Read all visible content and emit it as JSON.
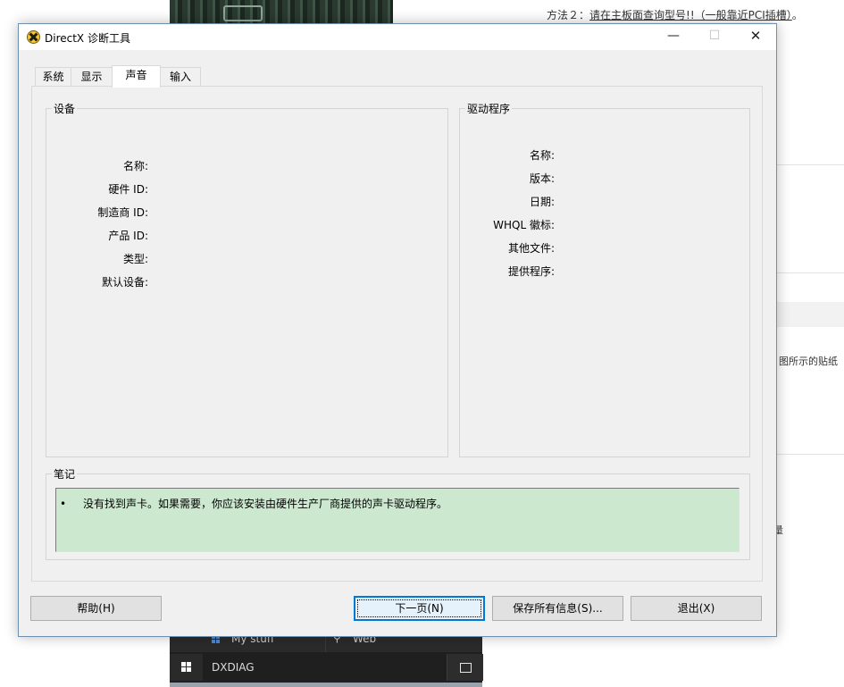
{
  "background": {
    "top_text_prefix": "方法２：",
    "top_text_link": "请在主板面查询型号!!（一般靠近PCI插槽）",
    "top_text_suffix": "。",
    "side_text": "图所示的贴纸",
    "side_mark": "量"
  },
  "start_menu": {
    "my_stuff_label": "My stuff",
    "web_label": "Web",
    "search_text": "DXDIAG"
  },
  "window": {
    "title": "DirectX 诊断工具",
    "controls": {
      "minimize": "—",
      "maximize": "☐",
      "close": "✕"
    }
  },
  "tabs": [
    {
      "label": "系统",
      "active": false
    },
    {
      "label": "显示",
      "active": false
    },
    {
      "label": "声音",
      "active": true
    },
    {
      "label": "输入",
      "active": false
    }
  ],
  "device_group": {
    "title": "设备",
    "fields": [
      {
        "label": "名称:",
        "value": ""
      },
      {
        "label": "硬件 ID:",
        "value": ""
      },
      {
        "label": "制造商 ID:",
        "value": ""
      },
      {
        "label": "产品 ID:",
        "value": ""
      },
      {
        "label": "类型:",
        "value": ""
      },
      {
        "label": "默认设备:",
        "value": ""
      }
    ]
  },
  "driver_group": {
    "title": "驱动程序",
    "fields": [
      {
        "label": "名称:",
        "value": ""
      },
      {
        "label": "版本:",
        "value": ""
      },
      {
        "label": "日期:",
        "value": ""
      },
      {
        "label": "WHQL 徽标:",
        "value": ""
      },
      {
        "label": "其他文件:",
        "value": ""
      },
      {
        "label": "提供程序:",
        "value": ""
      }
    ]
  },
  "notes": {
    "title": "笔记",
    "bullet": "•",
    "items": [
      "没有找到声卡。如果需要，你应该安装由硬件生产厂商提供的声卡驱动程序。"
    ]
  },
  "buttons": {
    "help": "帮助(H)",
    "next": "下一页(N)",
    "save": "保存所有信息(S)...",
    "exit": "退出(X)"
  }
}
